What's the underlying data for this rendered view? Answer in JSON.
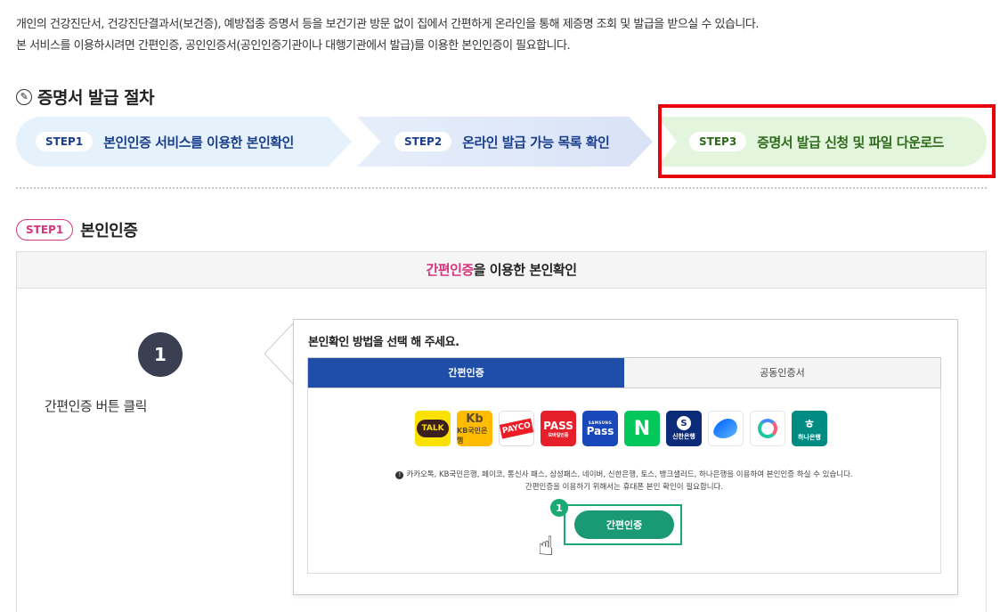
{
  "intro": {
    "line1": "개인의 건강진단서, 건강진단결과서(보건증), 예방접종 증명서 등을 보건기관 방문 없이 집에서 간편하게 온라인을 통해 제증명 조회 및 발급을 받으실 수 있습니다.",
    "line2": "본 서비스를 이용하시려면 간편인증, 공인인증서(공인인증기관이나 대행기관에서 발급)를 이용한 본인인증이 필요합니다."
  },
  "procedure": {
    "title": "증명서 발급 절차",
    "steps": [
      {
        "badge": "STEP1",
        "label": "본인인증 서비스를 이용한 본인확인"
      },
      {
        "badge": "STEP2",
        "label": "온라인 발급 가능 목록 확인"
      },
      {
        "badge": "STEP3",
        "label": "증명서 발급 신청 및 파일 다운로드"
      }
    ]
  },
  "section": {
    "badge": "STEP1",
    "title": "본인인증"
  },
  "panel": {
    "head_highlight": "간편인증",
    "head_rest": "을 이용한 본인확인",
    "step_number": "1",
    "left_label": "간편인증 버튼 클릭"
  },
  "dialog": {
    "title": "본인확인 방법을 선택 해 주세요.",
    "tabs": [
      "간편인증",
      "공동인증서"
    ],
    "apps": {
      "kakao": "TALK",
      "kb_logo": "Kb",
      "kb_name": "KB국민은행",
      "payco": "PAYCO",
      "pass": "PASS",
      "pass_sub": "모바일인증",
      "spass_top": "SAMSUNG",
      "spass": "Pass",
      "naver": "N",
      "shinhan_logo": "S",
      "shinhan": "신한은행",
      "hana_logo": "ㅎ",
      "hana": "하나은행"
    },
    "notice_line1": "카카오톡, KB국민은행, 페이코, 통신사 패스, 삼성패스, 네이버, 신한은행, 토스, 뱅크샐러드, 하나은행을 이용하여 본인인증 하실 수 있습니다.",
    "notice_line2": "간편인증을 이용하기 위해서는 휴대폰 본인 확인이 필요합니다.",
    "button": "간편인증",
    "callout_number": "1"
  },
  "colors": {
    "accent_blue": "#1f4ea8",
    "accent_pink": "#d4367e",
    "accent_green": "#1a9a74",
    "highlight_red": "#e8000b"
  }
}
